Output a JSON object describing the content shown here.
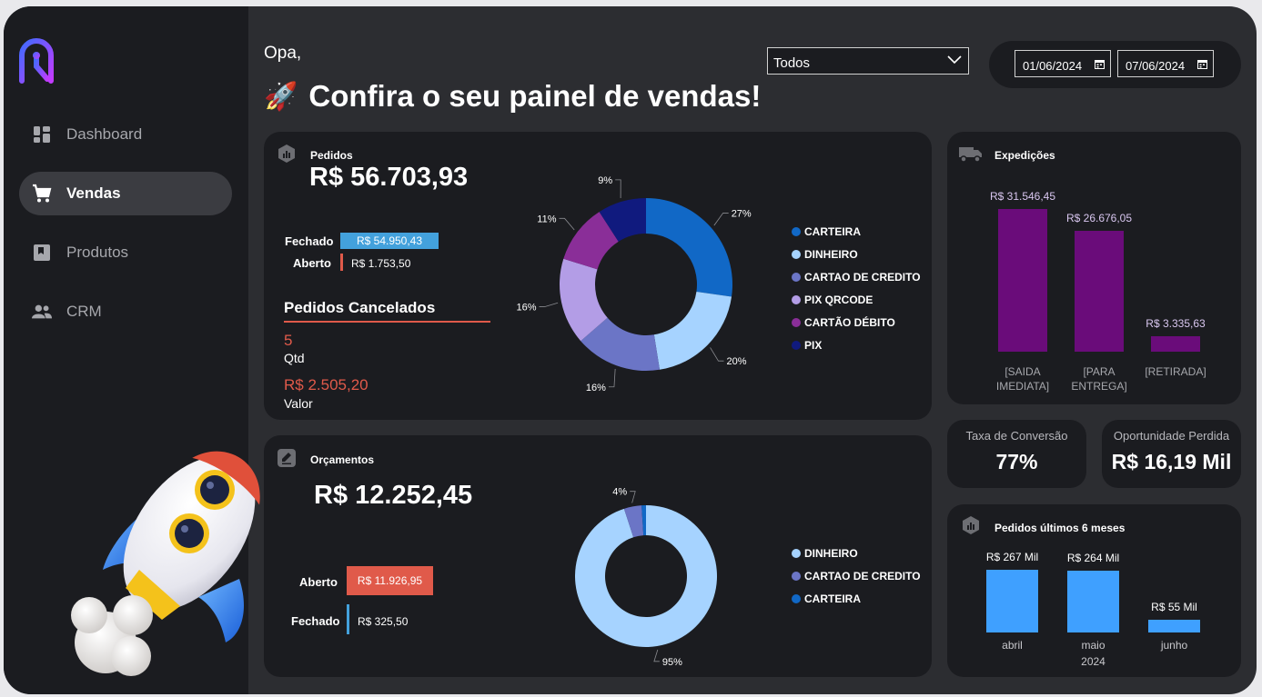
{
  "nav": {
    "items": [
      {
        "label": "Dashboard",
        "icon": "dashboard-icon"
      },
      {
        "label": "Vendas",
        "icon": "cart-icon",
        "active": true
      },
      {
        "label": "Produtos",
        "icon": "product-icon"
      },
      {
        "label": "CRM",
        "icon": "people-icon"
      }
    ]
  },
  "header": {
    "greeting": "Opa,",
    "emoji": "🚀",
    "title": "Confira o seu painel de vendas!",
    "filter_value": "Todos",
    "date_start": "01/06/2024",
    "date_end": "07/06/2024"
  },
  "pedidos": {
    "title": "Pedidos",
    "total": "R$ 56.703,93",
    "fechado_label": "Fechado",
    "fechado_value": "R$ 54.950,43",
    "fechado_fraction": 1.0,
    "aberto_label": "Aberto",
    "aberto_value": "R$ 1.753,50",
    "cancelados_title": "Pedidos Cancelados",
    "cancelados_qtd": "5",
    "qtd_label": "Qtd",
    "cancelados_valor": "R$ 2.505,20",
    "valor_label": "Valor"
  },
  "orcamentos": {
    "title": "Orçamentos",
    "total": "R$ 12.252,45",
    "aberto_label": "Aberto",
    "aberto_value": "R$ 11.926,95",
    "fechado_label": "Fechado",
    "fechado_value": "R$ 325,50"
  },
  "expedicoes": {
    "title": "Expedições"
  },
  "kpis": {
    "conversao_title": "Taxa de Conversão",
    "conversao_value": "77%",
    "perdida_title": "Oportunidade Perdida",
    "perdida_value": "R$ 16,19 Mil"
  },
  "meses": {
    "title": "Pedidos últimos 6 meses"
  },
  "colors": {
    "accent_blue": "#3fa0ff",
    "purple": "#6a0c7a",
    "red": "#e05a4a",
    "light_blue": "#43a1dc"
  },
  "chart_data": [
    {
      "type": "pie",
      "name": "pedidos-pagamento",
      "categories": [
        "CARTEIRA",
        "DINHEIRO",
        "CARTAO DE CREDITO",
        "PIX QRCODE",
        "CARTÃO DÉBITO",
        "PIX"
      ],
      "values": [
        27,
        20,
        16,
        16,
        11,
        9
      ],
      "labels": [
        "27%",
        "20%",
        "16%",
        "16%",
        "11%",
        "9%"
      ],
      "colors": [
        "#1168c6",
        "#a6d3ff",
        "#6b75c6",
        "#b39de6",
        "#8a2e98",
        "#101a7e"
      ]
    },
    {
      "type": "pie",
      "name": "orcamentos-pagamento",
      "categories": [
        "DINHEIRO",
        "CARTAO DE CREDITO",
        "CARTEIRA"
      ],
      "values": [
        95,
        4,
        1
      ],
      "labels": [
        "95%",
        "4%",
        ""
      ],
      "colors": [
        "#a6d3ff",
        "#6b75c6",
        "#1168c6"
      ]
    },
    {
      "type": "bar",
      "name": "expedicoes",
      "categories": [
        "[SAIDA IMEDIATA]",
        "[PARA ENTREGA]",
        "[RETIRADA]"
      ],
      "values": [
        31546.45,
        26676.05,
        3335.63
      ],
      "labels": [
        "R$ 31.546,45",
        "R$ 26.676,05",
        "R$ 3.335,63"
      ],
      "ylim": [
        0,
        31546.45
      ]
    },
    {
      "type": "bar",
      "name": "pedidos-6-meses",
      "categories": [
        "abril",
        "maio",
        "junho"
      ],
      "sublabel": "2024",
      "values": [
        267,
        264,
        55
      ],
      "labels": [
        "R$ 267 Mil",
        "R$ 264 Mil",
        "R$ 55 Mil"
      ],
      "ylim": [
        0,
        267
      ]
    }
  ]
}
